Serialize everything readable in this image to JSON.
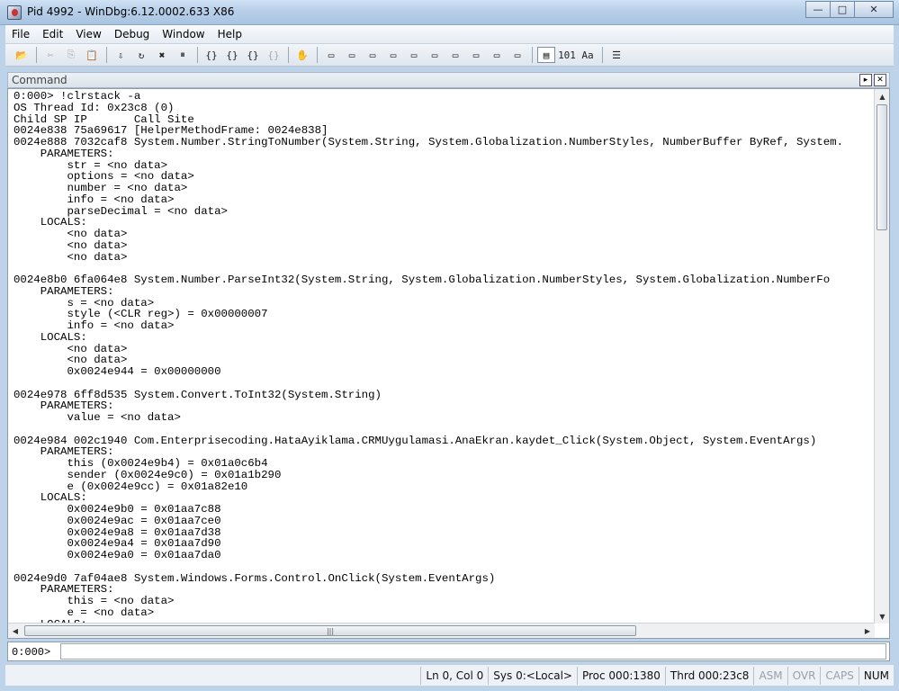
{
  "window": {
    "title": "Pid 4992 - WinDbg:6.12.0002.633 X86",
    "minimize": "—",
    "maximize": "□",
    "close": "✕"
  },
  "menu": [
    {
      "label": "File"
    },
    {
      "label": "Edit"
    },
    {
      "label": "View"
    },
    {
      "label": "Debug"
    },
    {
      "label": "Window"
    },
    {
      "label": "Help"
    }
  ],
  "toolbar": [
    {
      "name": "open-icon",
      "glyph": "📂",
      "enabled": true
    },
    {
      "sep": true
    },
    {
      "name": "cut-icon",
      "glyph": "✂",
      "enabled": false
    },
    {
      "name": "copy-icon",
      "glyph": "⎘",
      "enabled": false
    },
    {
      "name": "paste-icon",
      "glyph": "📋",
      "enabled": false
    },
    {
      "sep": true
    },
    {
      "name": "go-icon",
      "glyph": "⇩",
      "enabled": true
    },
    {
      "name": "restart-icon",
      "glyph": "↻",
      "enabled": true
    },
    {
      "name": "stop-debugging-icon",
      "glyph": "✖",
      "enabled": true
    },
    {
      "name": "break-icon",
      "glyph": "⏸",
      "enabled": true
    },
    {
      "sep": true
    },
    {
      "name": "step-into-icon",
      "glyph": "{}",
      "enabled": true
    },
    {
      "name": "step-over-icon",
      "glyph": "{}",
      "enabled": true
    },
    {
      "name": "step-out-icon",
      "glyph": "{}",
      "enabled": true
    },
    {
      "name": "run-to-cursor-icon",
      "glyph": "{}",
      "enabled": false
    },
    {
      "sep": true
    },
    {
      "name": "hand-icon",
      "glyph": "✋",
      "enabled": true
    },
    {
      "sep": true
    },
    {
      "name": "command-window-icon",
      "glyph": "▭",
      "enabled": true
    },
    {
      "name": "watch-window-icon",
      "glyph": "▭",
      "enabled": true
    },
    {
      "name": "locals-window-icon",
      "glyph": "▭",
      "enabled": true
    },
    {
      "name": "registers-window-icon",
      "glyph": "▭",
      "enabled": true
    },
    {
      "name": "memory-window-icon",
      "glyph": "▭",
      "enabled": true
    },
    {
      "name": "callstack-window-icon",
      "glyph": "▭",
      "enabled": true
    },
    {
      "name": "disassembly-window-icon",
      "glyph": "▭",
      "enabled": true
    },
    {
      "name": "scratch-pad-icon",
      "glyph": "▭",
      "enabled": true
    },
    {
      "name": "processes-threads-icon",
      "glyph": "▭",
      "enabled": true
    },
    {
      "name": "source-mode-icon",
      "glyph": "▭",
      "enabled": true
    },
    {
      "sep": true
    },
    {
      "name": "source-mode-toggle-icon",
      "glyph": "▤",
      "enabled": true,
      "active": true
    },
    {
      "name": "hex-display-icon",
      "glyph": "101",
      "enabled": true
    },
    {
      "name": "font-icon",
      "glyph": "Aa",
      "enabled": true
    },
    {
      "sep": true
    },
    {
      "name": "options-icon",
      "glyph": "☰",
      "enabled": true
    }
  ],
  "command_window": {
    "title": "Command",
    "output_lines": [
      "0:000> !clrstack -a",
      "OS Thread Id: 0x23c8 (0)",
      "Child SP IP       Call Site",
      "0024e838 75a69617 [HelperMethodFrame: 0024e838]",
      "0024e888 7032caf8 System.Number.StringToNumber(System.String, System.Globalization.NumberStyles, NumberBuffer ByRef, System.",
      "    PARAMETERS:",
      "        str = <no data>",
      "        options = <no data>",
      "        number = <no data>",
      "        info = <no data>",
      "        parseDecimal = <no data>",
      "    LOCALS:",
      "        <no data>",
      "        <no data>",
      "        <no data>",
      "",
      "0024e8b0 6fa064e8 System.Number.ParseInt32(System.String, System.Globalization.NumberStyles, System.Globalization.NumberFo",
      "    PARAMETERS:",
      "        s = <no data>",
      "        style (<CLR reg>) = 0x00000007",
      "        info = <no data>",
      "    LOCALS:",
      "        <no data>",
      "        <no data>",
      "        0x0024e944 = 0x00000000",
      "",
      "0024e978 6ff8d535 System.Convert.ToInt32(System.String)",
      "    PARAMETERS:",
      "        value = <no data>",
      "",
      "0024e984 002c1940 Com.Enterprisecoding.HataAyiklama.CRMUygulamasi.AnaEkran.kaydet_Click(System.Object, System.EventArgs)",
      "    PARAMETERS:",
      "        this (0x0024e9b4) = 0x01a0c6b4",
      "        sender (0x0024e9c0) = 0x01a1b290",
      "        e (0x0024e9cc) = 0x01a82e10",
      "    LOCALS:",
      "        0x0024e9b0 = 0x01aa7c88",
      "        0x0024e9ac = 0x01aa7ce0",
      "        0x0024e9a8 = 0x01aa7d38",
      "        0x0024e9a4 = 0x01aa7d90",
      "        0x0024e9a0 = 0x01aa7da0",
      "",
      "0024e9d0 7af04ae8 System.Windows.Forms.Control.OnClick(System.EventArgs)",
      "    PARAMETERS:",
      "        this = <no data>",
      "        e = <no data>",
      "    LOCALS:"
    ],
    "prompt": "0:000>",
    "input_value": ""
  },
  "statusbar": [
    {
      "name": "status-line-col",
      "text": "Ln 0, Col 0",
      "dim": false
    },
    {
      "name": "status-sys",
      "text": "Sys 0:<Local>",
      "dim": false
    },
    {
      "name": "status-proc",
      "text": "Proc 000:1380",
      "dim": false
    },
    {
      "name": "status-thrd",
      "text": "Thrd 000:23c8",
      "dim": false
    },
    {
      "name": "status-asm",
      "text": "ASM",
      "dim": true
    },
    {
      "name": "status-ovr",
      "text": "OVR",
      "dim": true
    },
    {
      "name": "status-caps",
      "text": "CAPS",
      "dim": true
    },
    {
      "name": "status-num",
      "text": "NUM",
      "dim": false
    }
  ]
}
